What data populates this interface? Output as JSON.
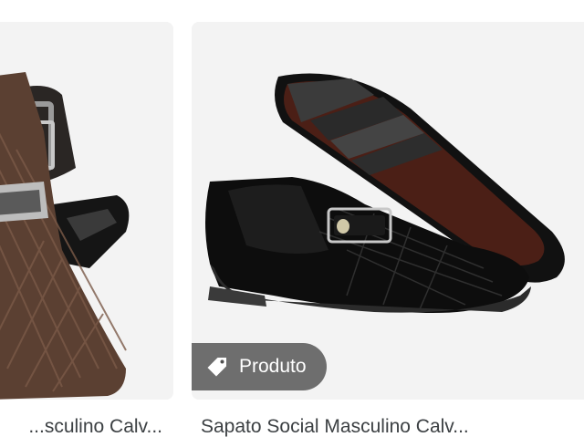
{
  "results": [
    {
      "title": "Sapato Social Masculino Calv...",
      "title_visible": "...sculino Calv...",
      "image_icon": "shoe-with-belt-image"
    },
    {
      "title": "Sapato Social Masculino Calv...",
      "chip_label": "Produto",
      "chip_icon": "tag-icon",
      "image_icon": "pair-of-black-shoes-image"
    }
  ],
  "colors": {
    "card_bg": "#f2f2f2",
    "title_text": "#3c4043",
    "chip_bg": "#505050",
    "chip_text": "#ffffff"
  }
}
